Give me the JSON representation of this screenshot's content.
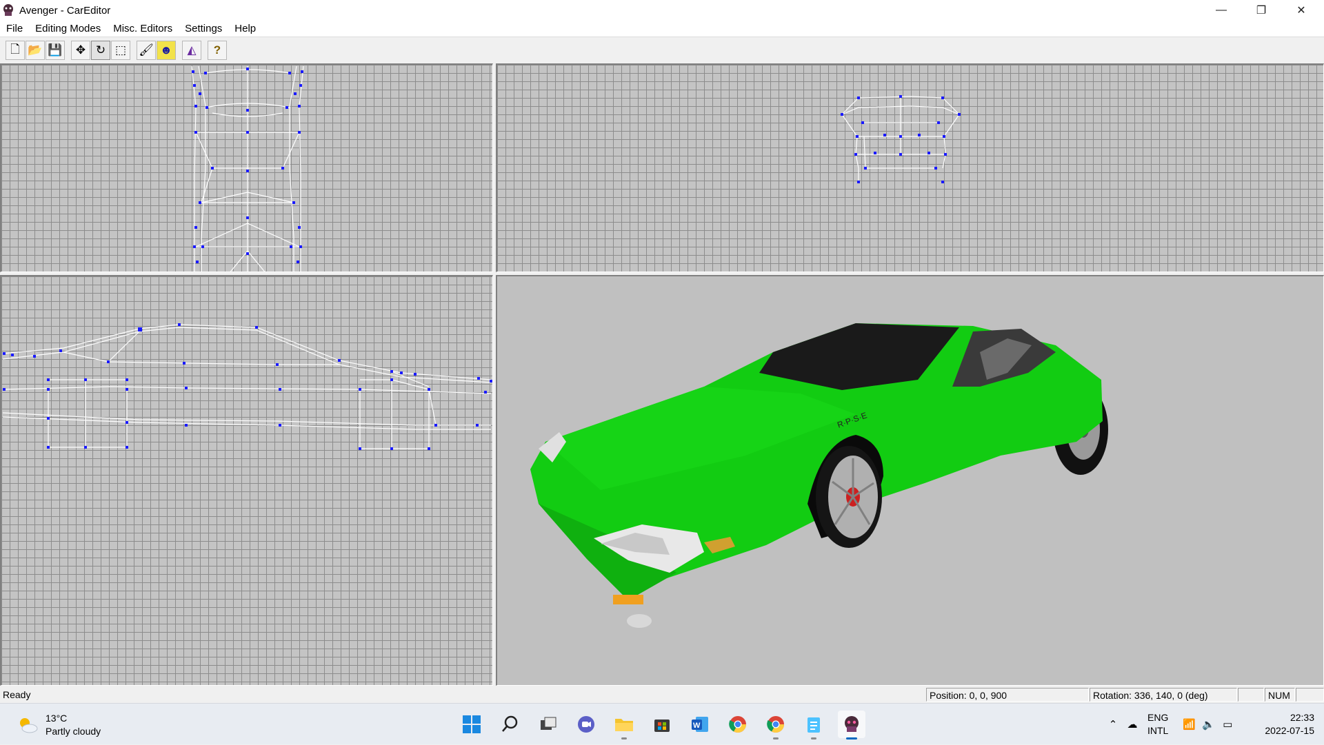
{
  "window": {
    "title": "Avenger - CarEditor",
    "controls": {
      "minimize": "—",
      "maximize": "❐",
      "close": "✕"
    }
  },
  "menu": {
    "items": [
      "File",
      "Editing Modes",
      "Misc. Editors",
      "Settings",
      "Help"
    ]
  },
  "toolbar": {
    "buttons": [
      {
        "name": "new-icon",
        "glyph": "🗋"
      },
      {
        "name": "open-folder-icon",
        "glyph": "📂"
      },
      {
        "name": "save-icon",
        "glyph": "💾"
      },
      {
        "name": "move-icon",
        "glyph": "✥"
      },
      {
        "name": "rotate-icon",
        "glyph": "↻"
      },
      {
        "name": "select-rectangle-icon",
        "glyph": "⬚"
      },
      {
        "name": "paint-icon",
        "glyph": "🖌"
      },
      {
        "name": "smiley-icon",
        "glyph": "☻"
      },
      {
        "name": "polygon-icon",
        "glyph": "◭"
      },
      {
        "name": "help-icon",
        "glyph": "?"
      }
    ]
  },
  "viewports": {
    "top": "top-view",
    "front": "front-view",
    "side": "side-view",
    "perspective": "3d-view",
    "car_color": "#12cc12",
    "wire_color": "#ffffff",
    "vertex_color": "#1a1aff"
  },
  "status": {
    "ready": "Ready",
    "position": "Position: 0, 0, 900",
    "rotation": "Rotation: 336, 140, 0 (deg)",
    "num": "NUM"
  },
  "taskbar": {
    "weather": {
      "temp": "13°C",
      "desc": "Partly cloudy"
    },
    "apps": [
      "start-icon",
      "search-icon",
      "task-view-icon",
      "chat-icon",
      "file-explorer-icon",
      "store-icon",
      "word-icon",
      "chrome-icon",
      "chrome-profile-icon",
      "notepad-icon",
      "careditor-icon"
    ],
    "tray": {
      "lang1": "ENG",
      "lang2": "INTL"
    },
    "clock": {
      "time": "22:33",
      "date": "2022-07-15"
    }
  }
}
